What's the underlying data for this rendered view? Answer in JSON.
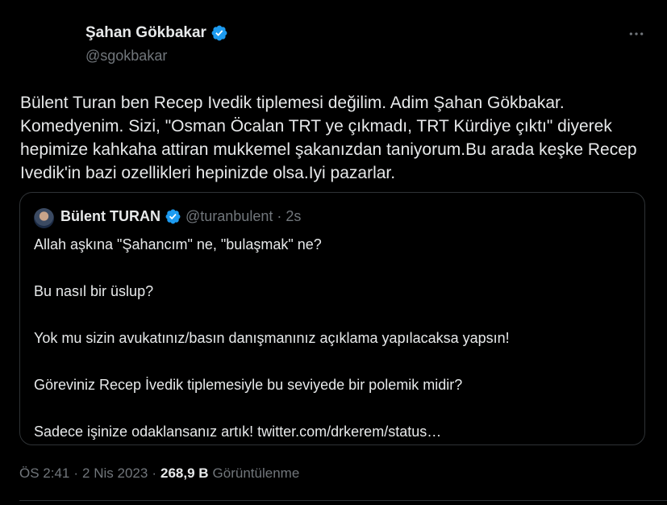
{
  "tweet": {
    "author": {
      "name": "Şahan Gökbakar",
      "handle": "@sgokbakar",
      "verified_icon": "verified-badge-icon"
    },
    "more_icon": "more-horizontal-icon",
    "text": "Bülent Turan ben Recep Ivedik tiplemesi değilim. Adim Şahan Gökbakar. Komedyenim. Sizi, \"Osman Öcalan TRT ye çıkmadı, TRT Kürdiye çıktı\" diyerek hepimize kahkaha attiran mukkemel şakanızdan taniyorum.Bu arada keşke Recep Ivedik'in bazi ozellikleri hepinizde olsa.Iyi pazarlar."
  },
  "quote": {
    "author": {
      "name": "Bülent TURAN",
      "handle": "@turanbulent",
      "separator": "·",
      "time": "2s"
    },
    "lines": [
      "Allah aşkına \"Şahancım\" ne, \"bulaşmak\" ne?",
      "",
      "Bu nasıl bir üslup?",
      "",
      "Yok mu sizin avukatınız/basın danışmanınız açıklama yapılacaksa yapsın!",
      "",
      "Göreviniz Recep İvedik tiplemesiyle bu seviyede bir polemik midir?",
      "",
      "Sadece işinize odaklansanız artık! twitter.com/drkerem/status…"
    ]
  },
  "meta": {
    "time": "ÖS 2:41",
    "sep1": "·",
    "date": "2 Nis 2023",
    "sep2": "·",
    "views_count": "268,9 B",
    "views_label": "Görüntülenme"
  },
  "colors": {
    "background": "#000000",
    "text": "#e7e9ea",
    "secondary": "#71767b",
    "border": "#2f3336",
    "verified": "#1d9bf0"
  }
}
